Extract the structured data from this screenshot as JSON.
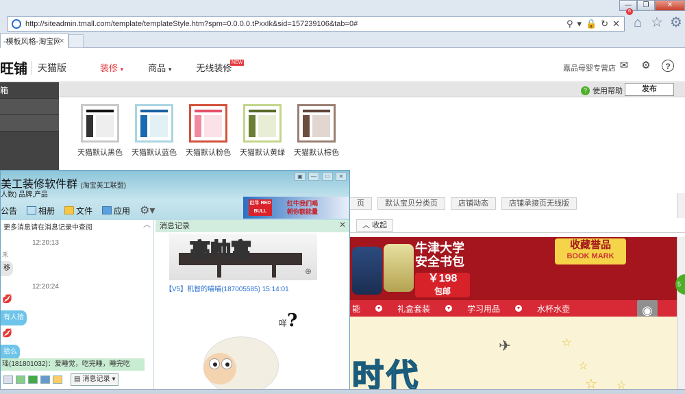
{
  "browser": {
    "url": "http://siteadmin.tmall.com/template/templateStyle.htm?spm=0.0.0.0.tPxxIk&sid=157239106&tab=0#",
    "tab_title": "-模板风格-淘宝网",
    "tab_close": "×"
  },
  "header": {
    "logo": "旺铺",
    "logo_sub": "天猫版",
    "nav": [
      {
        "label": "装修",
        "caret": "▾"
      },
      {
        "label": "商品",
        "caret": "▾"
      },
      {
        "label": "无线装修",
        "badge": "NEW"
      }
    ],
    "store_name": "嘉品母婴专营店",
    "mail_count": "6"
  },
  "sidebar": {
    "items": [
      "箱",
      "",
      ""
    ]
  },
  "toolbar": {
    "help": "使用帮助",
    "publish": "发布"
  },
  "styles": [
    {
      "label": "天猫默认黑色",
      "border": "#c8c8c8",
      "accent": "#111111",
      "col": "#333333",
      "body": "#eeeeee"
    },
    {
      "label": "天猫默认蓝色",
      "border": "#a9d4e2",
      "accent": "#1a5fa3",
      "col": "#1a6ab3",
      "body": "#e3f1f6"
    },
    {
      "label": "天猫默认粉色",
      "border": "#d2513a",
      "accent": "#e4506a",
      "col": "#f08aa0",
      "body": "#fbe2e8"
    },
    {
      "label": "天猫默认黄绿",
      "border": "#c2d58a",
      "accent": "#56692a",
      "col": "#6a7f35",
      "body": "#e8eed5"
    },
    {
      "label": "天猫默认棕色",
      "border": "#9a7e72",
      "accent": "#5e4238",
      "col": "#6d4d40",
      "body": "#e2d6d1"
    }
  ],
  "page_tabs": [
    "页",
    "默认宝贝分类页",
    "店铺动态",
    "店铺承接页无线版"
  ],
  "collapse": "收起",
  "store_preview": {
    "promo_title_1": "牛津大学",
    "promo_title_2": "安全书包",
    "price": "￥198",
    "price_sub": "包邮",
    "bookmark": "收藏誉品",
    "bookmark_sub": "BOOK MARK",
    "nav": [
      "能",
      "礼盒套装",
      "学习用品",
      "水杯水壶"
    ],
    "hero_text": "时代"
  },
  "qq": {
    "title": "美工装修软件群",
    "title_tag": "(淘宝美工联盟)",
    "subtitle": "人数) 品牌,产品",
    "tabs": [
      "公告",
      "相册",
      "文件",
      "应用"
    ],
    "ad_logo": "红牛 RED BULL",
    "ad_text_1": "红牛我们喝",
    "ad_text_2": "朝你额能量",
    "chat": {
      "note": "更多消息请在消息记录中查阅",
      "time1": "12:20:13",
      "name1": "禾",
      "msg1": "移",
      "time2": "12:20:24",
      "msg2": "有人拾",
      "msg3": "拾么",
      "last_line": "瑶(181801032)：爱睡觉，吃完睡，睡完吃"
    },
    "history": {
      "title": "消息记录",
      "img_text": "高帅富",
      "sender": "【V5】机智的喵喵(187005585) 15:14:01",
      "caption": "咩",
      "question": "?"
    },
    "msg_record_btn": "消息记录"
  }
}
